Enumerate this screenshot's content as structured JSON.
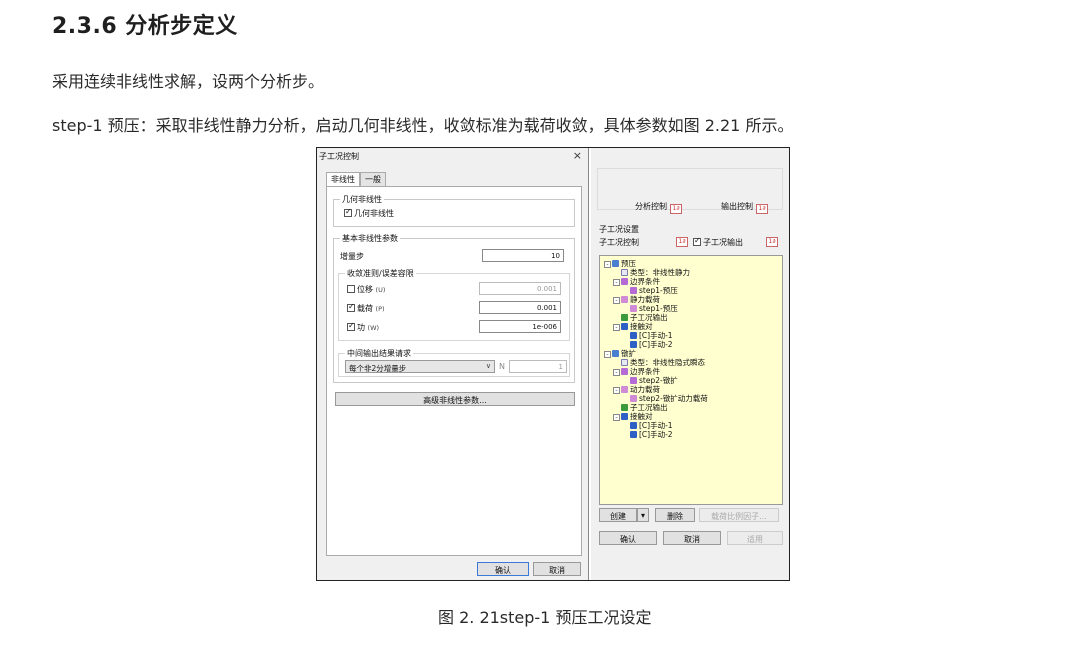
{
  "heading": "2.3.6 分析步定义",
  "para1": "采用连续非线性求解，设两个分析步。",
  "para2": "step-1 预压：采取非线性静力分析，启动几何非线性，收敛标准为载荷收敛，具体参数如图 2.21 所示。",
  "caption": "图 2. 21step-1 预压工况设定",
  "dialog": {
    "title": "子工况控制",
    "close": "×",
    "tabs": [
      "非线性",
      "一般"
    ],
    "geo_group": "几何非线性",
    "geo_checkbox": "几何非线性",
    "basic_group": "基本非线性参数",
    "increment_label": "增量步",
    "increment_value": "10",
    "conv_group": "收敛准则/误差容限",
    "conv_rows": [
      {
        "label": "位移",
        "unit": "(U)",
        "checked": false,
        "value": "0.001"
      },
      {
        "label": "载荷",
        "unit": "(P)",
        "checked": true,
        "value": "0.001"
      },
      {
        "label": "功",
        "unit": "(W)",
        "checked": true,
        "value": "1e-006"
      }
    ],
    "mid_group": "中间输出结果请求",
    "mid_select": "每个非2分增量步",
    "mid_n_label": "N",
    "mid_n_value": "1",
    "advanced_button": "高级非线性参数...",
    "ok": "确认",
    "cancel": "取消"
  },
  "panel": {
    "analysis_control": "分析控制",
    "output_control": "输出控制",
    "level_icon": "1∂",
    "sub_group": "子工况设置",
    "sub_control": "子工况控制",
    "sub_output": "子工况输出",
    "tree": [
      {
        "level": 0,
        "icon": "folder",
        "toggle": "-",
        "text": "预压"
      },
      {
        "level": 1,
        "icon": "doc",
        "toggle": "",
        "text": "类型：非线性静力"
      },
      {
        "level": 1,
        "icon": "bc",
        "toggle": "-",
        "text": "边界条件"
      },
      {
        "level": 2,
        "icon": "bc",
        "toggle": "",
        "text": "step1-预压"
      },
      {
        "level": 1,
        "icon": "load",
        "toggle": "-",
        "text": "静力载荷"
      },
      {
        "level": 2,
        "icon": "load",
        "toggle": "",
        "text": "step1-预压"
      },
      {
        "level": 1,
        "icon": "out",
        "toggle": "",
        "text": "子工况输出"
      },
      {
        "level": 1,
        "icon": "contact",
        "toggle": "-",
        "text": "接触对"
      },
      {
        "level": 2,
        "icon": "contact",
        "toggle": "",
        "text": "[C]手动-1"
      },
      {
        "level": 2,
        "icon": "contact",
        "toggle": "",
        "text": "[C]手动-2"
      },
      {
        "level": 0,
        "icon": "folder",
        "toggle": "-",
        "text": "镦扩"
      },
      {
        "level": 1,
        "icon": "doc",
        "toggle": "",
        "text": "类型：非线性隐式瞬态"
      },
      {
        "level": 1,
        "icon": "bc",
        "toggle": "-",
        "text": "边界条件"
      },
      {
        "level": 2,
        "icon": "bc",
        "toggle": "",
        "text": "step2-镦扩"
      },
      {
        "level": 1,
        "icon": "load",
        "toggle": "-",
        "text": "动力载荷"
      },
      {
        "level": 2,
        "icon": "load",
        "toggle": "",
        "text": "step2-镦扩动力载荷"
      },
      {
        "level": 1,
        "icon": "out",
        "toggle": "",
        "text": "子工况输出"
      },
      {
        "level": 1,
        "icon": "contact",
        "toggle": "-",
        "text": "接触对"
      },
      {
        "level": 2,
        "icon": "contact",
        "toggle": "",
        "text": "[C]手动-1"
      },
      {
        "level": 2,
        "icon": "contact",
        "toggle": "",
        "text": "[C]手动-2"
      }
    ],
    "create": "创建",
    "delete": "删除",
    "load_factor": "载荷比例因子...",
    "ok": "确认",
    "cancel": "取消",
    "apply": "适用"
  }
}
